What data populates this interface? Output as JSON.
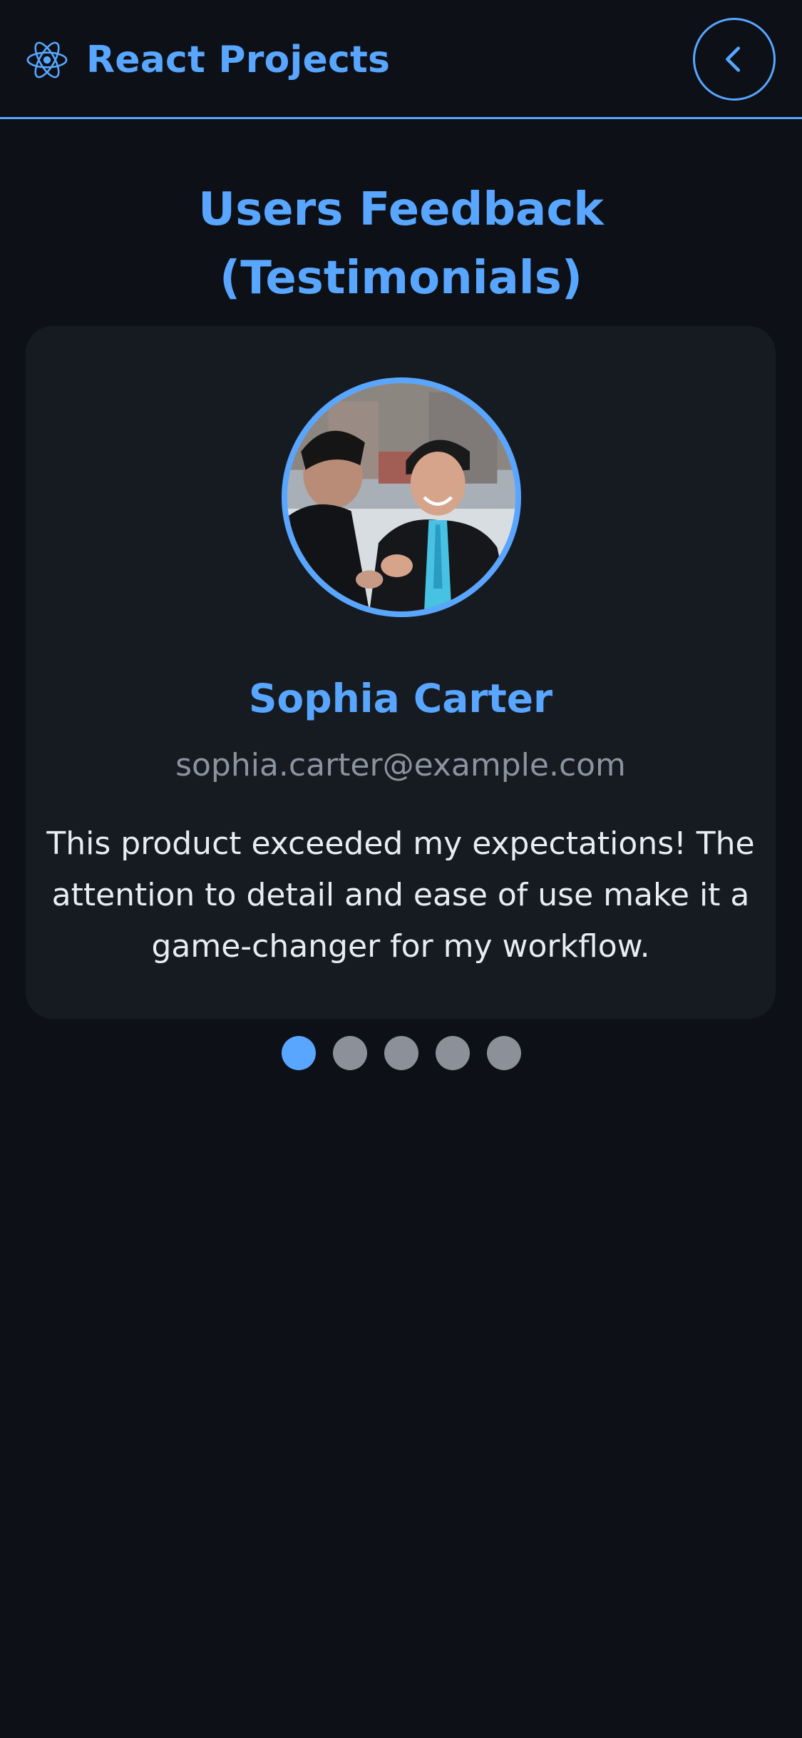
{
  "header": {
    "title": "React Projects",
    "logo_icon": "react-atom-icon",
    "back_icon": "chevron-left-icon"
  },
  "section": {
    "title_line1": "Users Feedback",
    "title_line2": "(Testimonials)"
  },
  "testimonial": {
    "name": "Sophia Carter",
    "email": "sophia.carter@example.com",
    "text": "This product exceeded my expectations! The attention to detail and ease of use make it a game-changer for my workflow.",
    "avatar_icon": "user-photo"
  },
  "pagination": {
    "count": 5,
    "active_index": 0
  },
  "colors": {
    "background": "#0d1017",
    "card": "#161b22",
    "accent": "#58a6ff",
    "muted": "#8b949e",
    "text": "#e6edf3",
    "dot_inactive": "#8b9099"
  }
}
